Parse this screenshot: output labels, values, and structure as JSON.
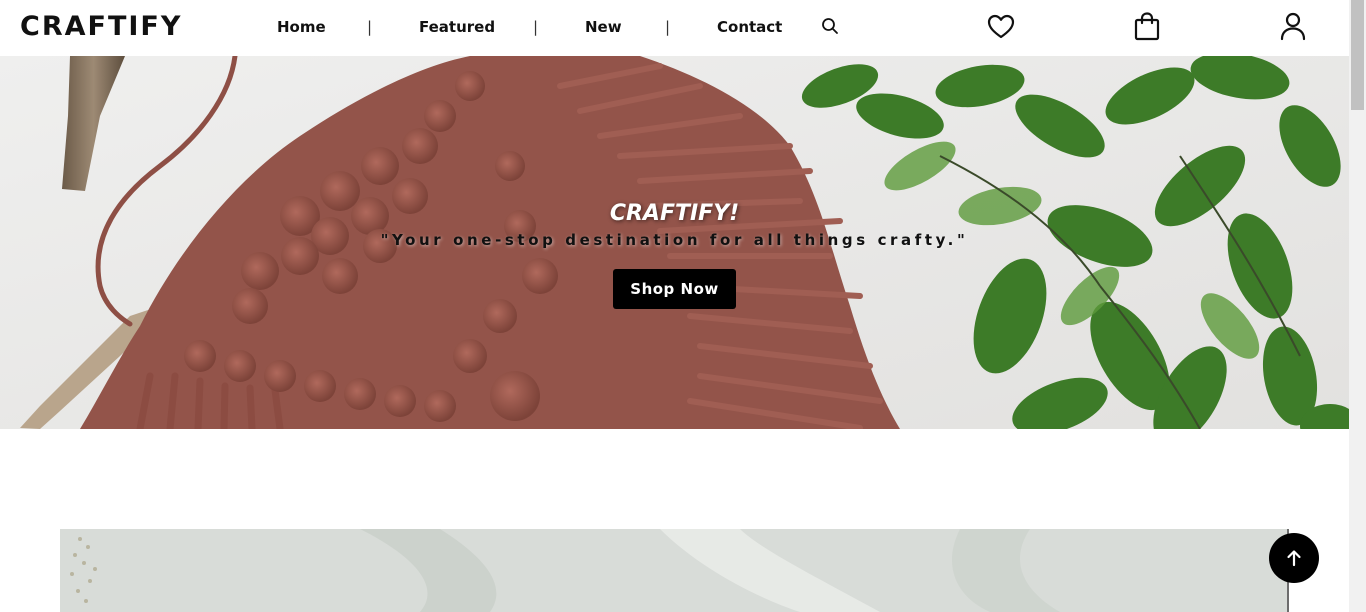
{
  "brand": {
    "logo": "CRAFTIFY"
  },
  "nav": {
    "items": [
      {
        "label": "Home"
      },
      {
        "label": "Featured"
      },
      {
        "label": "New"
      },
      {
        "label": "Contact"
      }
    ],
    "separator": "|",
    "icons": {
      "search": "search-icon",
      "wishlist": "heart-icon",
      "cart": "shopping-bag-icon",
      "account": "user-icon"
    }
  },
  "hero": {
    "title": "CRAFTIFY!",
    "tagline": "\"Your one-stop destination for all things crafty.\"",
    "cta_label": "Shop Now"
  },
  "back_to_top": {
    "icon": "arrow-up-icon"
  },
  "colors": {
    "text": "#111111",
    "button_bg": "#000000",
    "button_text": "#ffffff",
    "macrame": "#9c5a4f",
    "leaf": "#3f7d2a"
  }
}
